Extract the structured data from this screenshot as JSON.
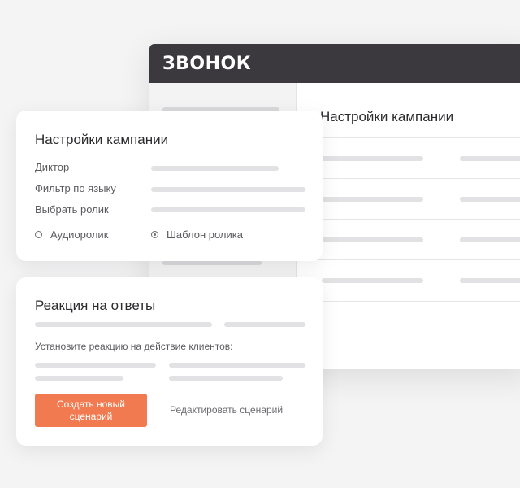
{
  "app": {
    "logo": "ЗВОНОК",
    "main_title": "Настройки кампании"
  },
  "campaign_card": {
    "title": "Настройки кампании",
    "fields": {
      "speaker_label": "Диктор",
      "language_filter_label": "Фильтр по языку",
      "choose_clip_label": "Выбрать ролик"
    },
    "radio_options": [
      {
        "label": "Аудиоролик",
        "selected": false
      },
      {
        "label": "Шаблон ролика",
        "selected": true
      }
    ]
  },
  "reaction_card": {
    "title": "Реакция на ответы",
    "instruction": "Установите реакцию на действие клиентов:",
    "create_button_label": "Создать новый сценарий",
    "edit_link_label": "Редактировать сценарий"
  },
  "colors": {
    "header_bg": "#3b393d",
    "accent": "#f27a50",
    "page_bg": "#f4f4f5"
  }
}
